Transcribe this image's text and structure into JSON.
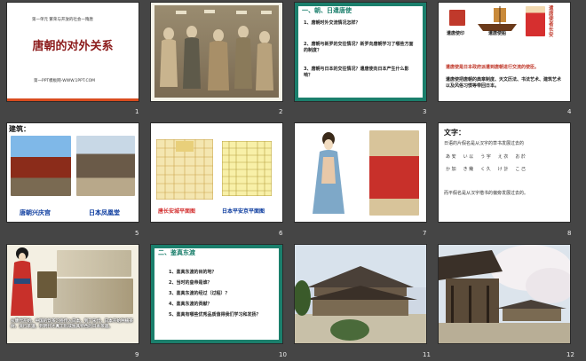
{
  "slide_numbers": [
    "1",
    "2",
    "3",
    "4",
    "5",
    "6",
    "7",
    "8",
    "9",
    "10",
    "11",
    "12"
  ],
  "s1": {
    "subtitle": "第一单元 繁荣与开放的社会一隋唐",
    "title": "唐朝的对外关系",
    "footer": "第一PPT模板网-WWW.1PPT.COM"
  },
  "s3": {
    "heading": "一、朝、日遣唐使",
    "q1": "1、唐朝时外交流情况怎样？",
    "q2": "2、唐朝与新罗的交往情况？新罗向唐朝学习了哪些方面的制度？",
    "q3": "3、唐朝与日本的交往情况？遣唐使向日本产生什么影响？"
  },
  "s4": {
    "side_text": "遣唐使者长安",
    "cap1": "遣唐使印",
    "cap2": "遣唐使船",
    "b1": "遣唐使是日本政府派遣到唐朝进行交流的使臣。",
    "b2": "遣唐使把唐朝的典章制度、天文历法、书法艺术、建筑艺术以及风俗习惯等带回日本。"
  },
  "s5": {
    "heading": "建筑：",
    "cap1": "唐朝兴庆宫",
    "cap2": "日本凤凰堂"
  },
  "s6": {
    "cap1": "唐长安城平面图",
    "cap2": "日本平安京平面图"
  },
  "s8": {
    "heading": "文字：",
    "l1": "日语的片假名是从汉字的草书发展过去的",
    "row1": [
      "あ 安",
      "い 以",
      "う 宇",
      "え 衣",
      "お 於"
    ],
    "row2": [
      "か 加",
      "き 幾",
      "く 久",
      "け 計",
      "こ 己"
    ],
    "l2": "而平假名是从汉字楷书的偏旁发展过去的。"
  },
  "s9": {
    "caption": "从唐代开始，中国的饮茶习俗传入日本，到了宋代，日本开始种植茶树，流行茶道，到明代才真正形成独具特色的日本茶道。"
  },
  "s10": {
    "heading": "二、鉴真东渡",
    "items": [
      "1、鉴真东渡的目的地？",
      "2、当时的皇帝是谁？",
      "3、鉴真东渡的经过（过程）？",
      "4、鉴真东渡的贡献？",
      "5、鉴真有哪些优秀品质值得我们学习和发扬？"
    ]
  }
}
